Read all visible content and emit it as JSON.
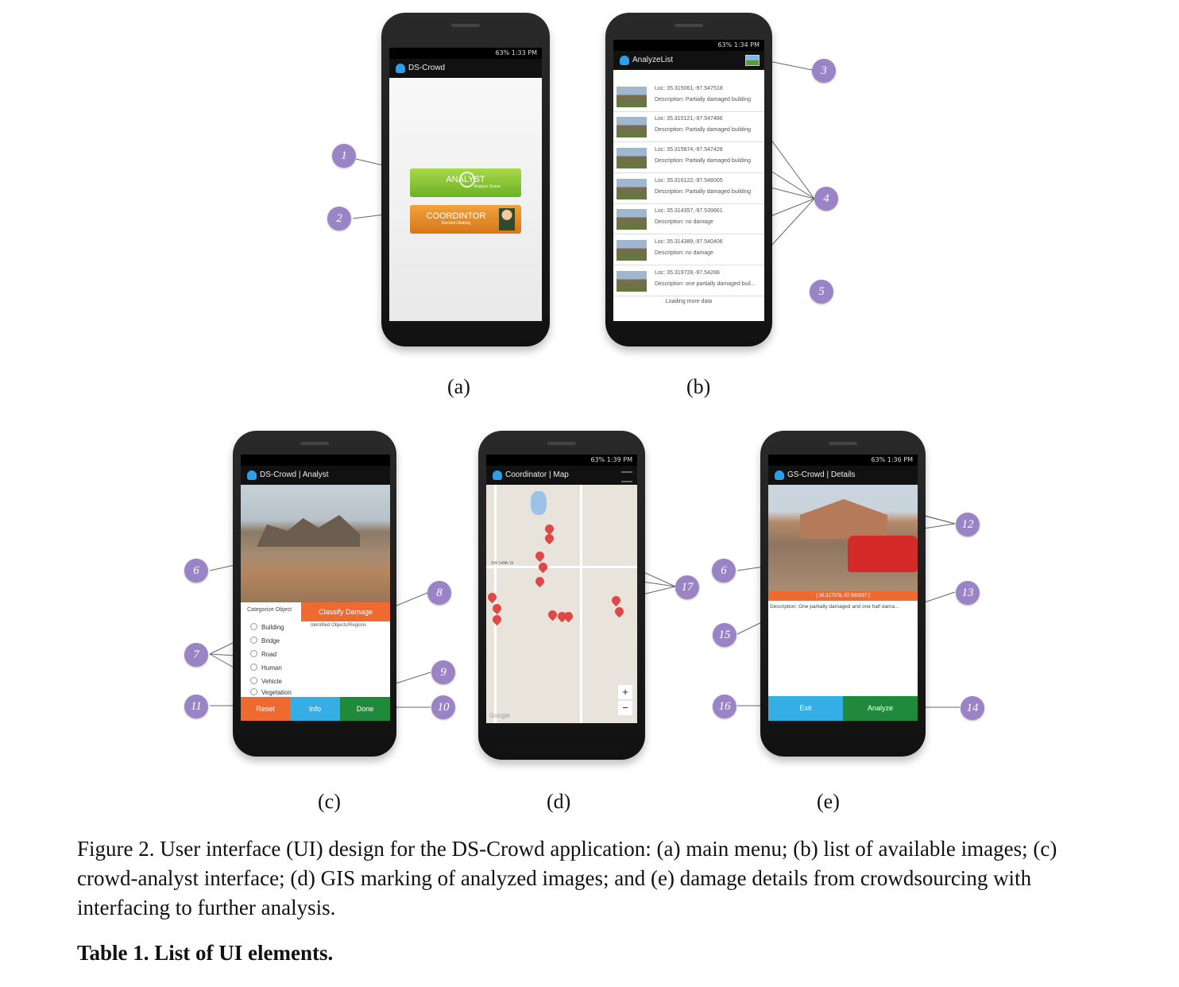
{
  "phones": {
    "a": {
      "status": "63% 1:33 PM",
      "title": "DS-Crowd",
      "analyst_label": "ANALYST",
      "analyst_sub": "Analyze Scene",
      "coord_label": "COORDINTOR",
      "coord_sub": "Decision Making"
    },
    "b": {
      "status": "63% 1:34 PM",
      "title": "AnalyzeList",
      "rows": [
        {
          "loc": "Loc: 35.315061,-97.547518",
          "desc": "Description: Partially damaged building"
        },
        {
          "loc": "Loc: 35.315121,-97.547486",
          "desc": "Description: Partially damaged building"
        },
        {
          "loc": "Loc: 35.315874,-97.547428",
          "desc": "Description: Partially damaged building"
        },
        {
          "loc": "Loc: 35.316122,-97.548005",
          "desc": "Description: Partially damaged building"
        },
        {
          "loc": "Loc: 35.314357,-97.539661",
          "desc": "Description: no damage"
        },
        {
          "loc": "Loc: 35.314389,-97.540406",
          "desc": "Description: no damage"
        },
        {
          "loc": "Loc: 35.319728,-97.54288",
          "desc": "Description: one partially damaged buil..."
        }
      ],
      "loading": "Loading more data"
    },
    "c": {
      "title": "DS-Crowd | Analyst",
      "categorize": "Categorize Object",
      "classify": "Classify Damage",
      "identified": "Identified Objects/Regions",
      "options": [
        "Building",
        "Bridge",
        "Road",
        "Human",
        "Vehicle",
        "Vegetation"
      ],
      "reset": "Reset",
      "info": "Info",
      "done": "Done"
    },
    "d": {
      "status": "63% 1:39 PM",
      "title": "Coordinator | Map",
      "street1": "SW 149th St",
      "google": "Google",
      "zoom_in": "+",
      "zoom_out": "−"
    },
    "e": {
      "status": "63% 1:36 PM",
      "title": "GS-Crowd | Details",
      "coords": "[ 35.317378,-97.563937 ]",
      "description": "Description: One partially damaged and one half dama...",
      "exit": "Exit",
      "analyze": "Analyze"
    }
  },
  "callouts": [
    "1",
    "2",
    "3",
    "4",
    "5",
    "6",
    "7",
    "8",
    "9",
    "10",
    "11",
    "6",
    "12",
    "13",
    "14",
    "15",
    "16",
    "17"
  ],
  "sublabels": [
    "(a)",
    "(b)",
    "(c)",
    "(d)",
    "(e)"
  ],
  "caption": "Figure 2. User interface (UI) design for the DS-Crowd application: (a) main menu; (b) list of available images; (c) crowd-analyst interface;  (d) GIS marking of analyzed images; and (e) damage details from crowdsourcing with interfacing to further analysis.",
  "table_title": "Table 1. List of UI elements."
}
